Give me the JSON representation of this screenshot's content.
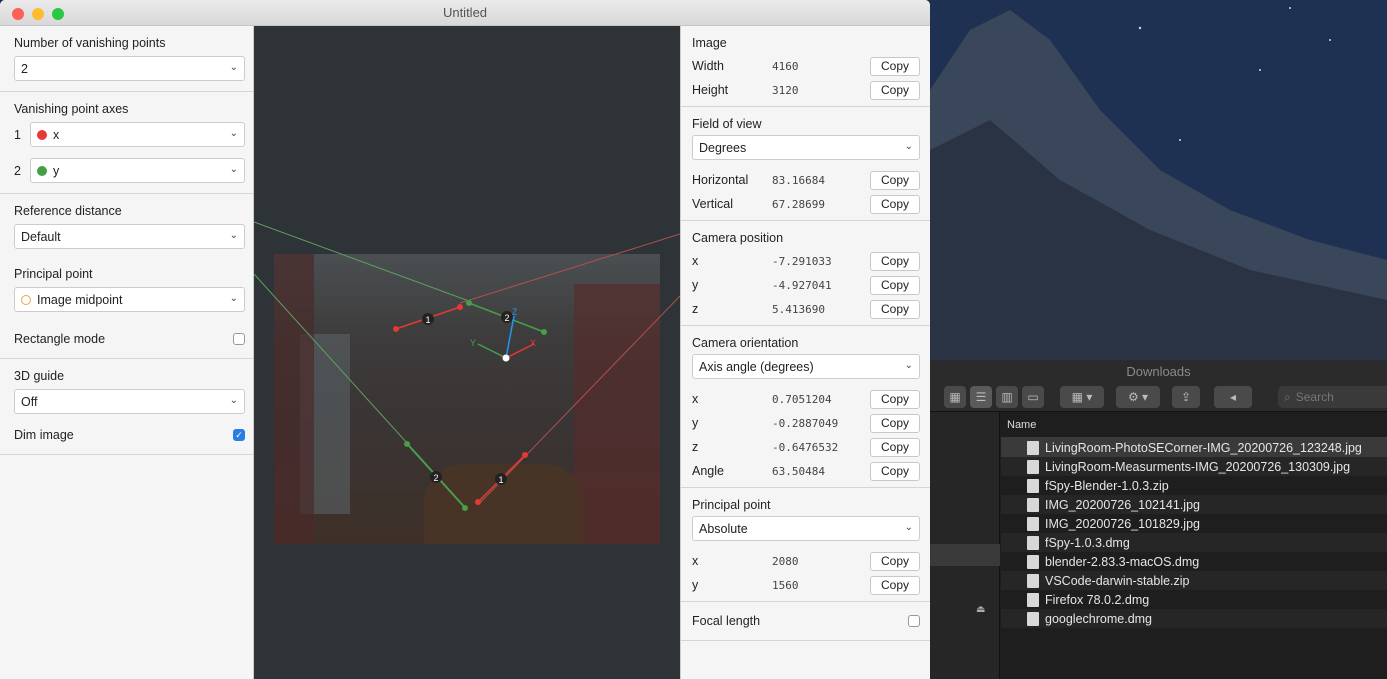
{
  "window": {
    "title": "Untitled"
  },
  "left": {
    "vanishing_points": {
      "label": "Number of vanishing points",
      "value": "2"
    },
    "axes": {
      "label": "Vanishing point axes",
      "items": [
        {
          "num": "1",
          "value": "x",
          "color": "#e53935"
        },
        {
          "num": "2",
          "value": "y",
          "color": "#43a047"
        }
      ]
    },
    "reference_distance": {
      "label": "Reference distance",
      "value": "Default"
    },
    "principal_point": {
      "label": "Principal point",
      "value": "Image midpoint"
    },
    "rectangle_mode": {
      "label": "Rectangle mode",
      "checked": false
    },
    "guide_3d": {
      "label": "3D guide",
      "value": "Off"
    },
    "dim_image": {
      "label": "Dim image",
      "checked": true
    }
  },
  "canvas": {
    "markers": [
      "1",
      "2",
      "2",
      "1"
    ],
    "axis_labels": {
      "z": "Z",
      "y": "Y",
      "x": "X"
    }
  },
  "right": {
    "image": {
      "header": "Image",
      "width_label": "Width",
      "width": "4160",
      "height_label": "Height",
      "height": "3120"
    },
    "fov": {
      "header": "Field of view",
      "unit": "Degrees",
      "h_label": "Horizontal",
      "h": "83.16684",
      "v_label": "Vertical",
      "v": "67.28699"
    },
    "camera_position": {
      "header": "Camera position",
      "x": "-7.291033",
      "y": "-4.927041",
      "z": "5.413690"
    },
    "camera_orientation": {
      "header": "Camera orientation",
      "mode": "Axis angle (degrees)",
      "x": "0.7051204",
      "y": "-0.2887049",
      "z": "-0.6476532",
      "angle_label": "Angle",
      "angle": "63.50484"
    },
    "principal_point": {
      "header": "Principal point",
      "mode": "Absolute",
      "x": "2080",
      "y": "1560"
    },
    "focal_length": {
      "label": "Focal length",
      "checked": false
    },
    "copy_label": "Copy",
    "x_label": "x",
    "y_label": "y",
    "z_label": "z"
  },
  "finder": {
    "title": "Downloads",
    "search_placeholder": "Search",
    "column_name": "Name",
    "files": [
      "LivingRoom-PhotoSECorner-IMG_20200726_123248.jpg",
      "LivingRoom-Measurments-IMG_20200726_130309.jpg",
      "fSpy-Blender-1.0.3.zip",
      "IMG_20200726_102141.jpg",
      "IMG_20200726_101829.jpg",
      "fSpy-1.0.3.dmg",
      "blender-2.83.3-macOS.dmg",
      "VSCode-darwin-stable.zip",
      "Firefox 78.0.2.dmg",
      "googlechrome.dmg"
    ]
  }
}
